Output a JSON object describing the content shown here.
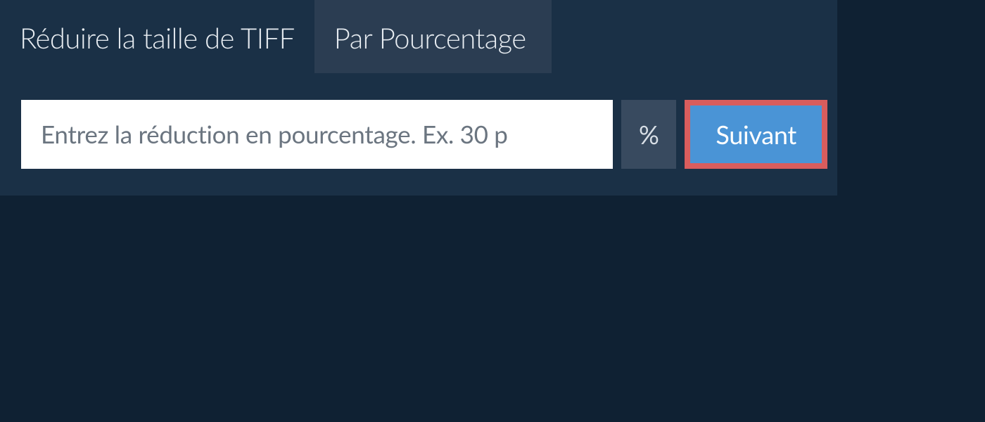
{
  "tabs": {
    "inactive_label": "Réduire la taille de TIFF",
    "active_label": "Par Pourcentage"
  },
  "input": {
    "placeholder": "Entrez la réduction en pourcentage. Ex. 30 p",
    "unit": "%"
  },
  "buttons": {
    "next": "Suivant"
  }
}
